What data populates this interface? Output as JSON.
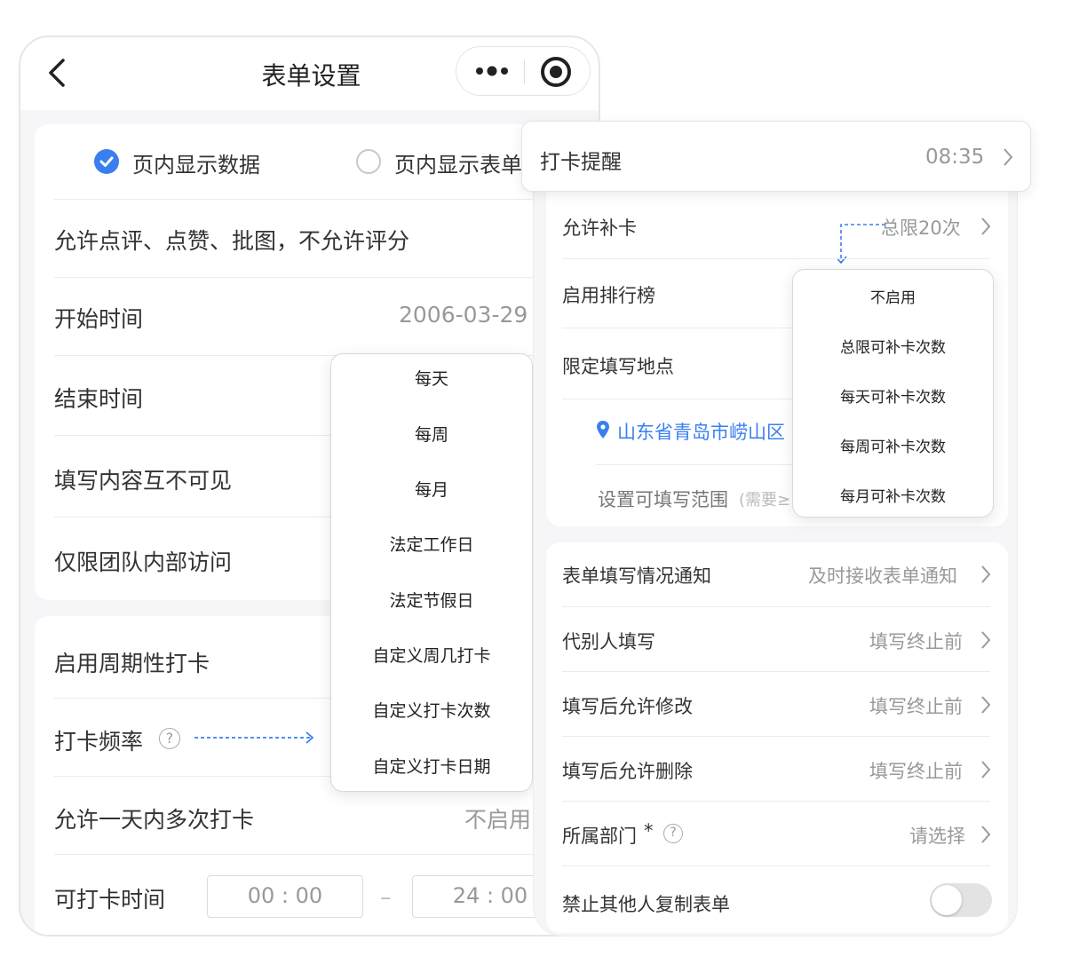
{
  "colors": {
    "accent": "#3a7ff0",
    "required": "#e5484d"
  },
  "nav": {
    "title": "表单设置",
    "back_icon": "chevron-left-icon",
    "more_icon": "more-dots-icon",
    "close_icon": "target-icon"
  },
  "display_mode": {
    "options": [
      {
        "label": "页内显示数据",
        "selected": true
      },
      {
        "label": "页内显示表单",
        "selected": false
      }
    ]
  },
  "settings": {
    "comment_rule": "允许点评、点赞、批图，不允许评分",
    "start_time": {
      "label": "开始时间",
      "value": "2006-03-29"
    },
    "end_time": {
      "label": "结束时间"
    },
    "content_invisible": {
      "label": "填写内容互不可见"
    },
    "team_only": {
      "label": "仅限团队内部访问"
    }
  },
  "checkin": {
    "periodic": {
      "label": "启用周期性打卡"
    },
    "frequency": {
      "label": "打卡频率",
      "help_icon": "question-circle-icon"
    },
    "multi_per_day": {
      "label": "允许一天内多次打卡",
      "value": "不启用"
    },
    "time_window": {
      "label": "可打卡时间",
      "start": "00 : 00",
      "separator": "–",
      "end": "24 : 00"
    }
  },
  "frequency_options": [
    "每天",
    "每周",
    "每月",
    "法定工作日",
    "法定节假日",
    "自定义周几打卡",
    "自定义打卡次数",
    "自定义打卡日期"
  ],
  "reminder": {
    "label": "打卡提醒",
    "value": "08:35"
  },
  "right": {
    "makeup": {
      "label": "允许补卡",
      "value": "总限20次"
    },
    "ranking": {
      "label": "启用排行榜"
    },
    "location": {
      "label": "限定填写地点"
    },
    "address": {
      "text": "山东省青岛市崂山区",
      "icon": "location-pin-icon"
    },
    "range": {
      "label": "设置可填写范围",
      "hint": "(需要≥"
    },
    "notify": {
      "label": "表单填写情况通知",
      "value": "及时接收表单通知"
    },
    "proxy": {
      "label": "代别人填写",
      "value": "填写终止前"
    },
    "allow_edit": {
      "label": "填写后允许修改",
      "value": "填写终止前"
    },
    "allow_delete": {
      "label": "填写后允许删除",
      "value": "填写终止前"
    },
    "department": {
      "label": "所属部门",
      "required_mark": "*",
      "value": "请选择"
    },
    "no_copy": {
      "label": "禁止其他人复制表单",
      "enabled": false
    }
  },
  "makeup_options": [
    "不启用",
    "总限可补卡次数",
    "每天可补卡次数",
    "每周可补卡次数",
    "每月可补卡次数"
  ]
}
